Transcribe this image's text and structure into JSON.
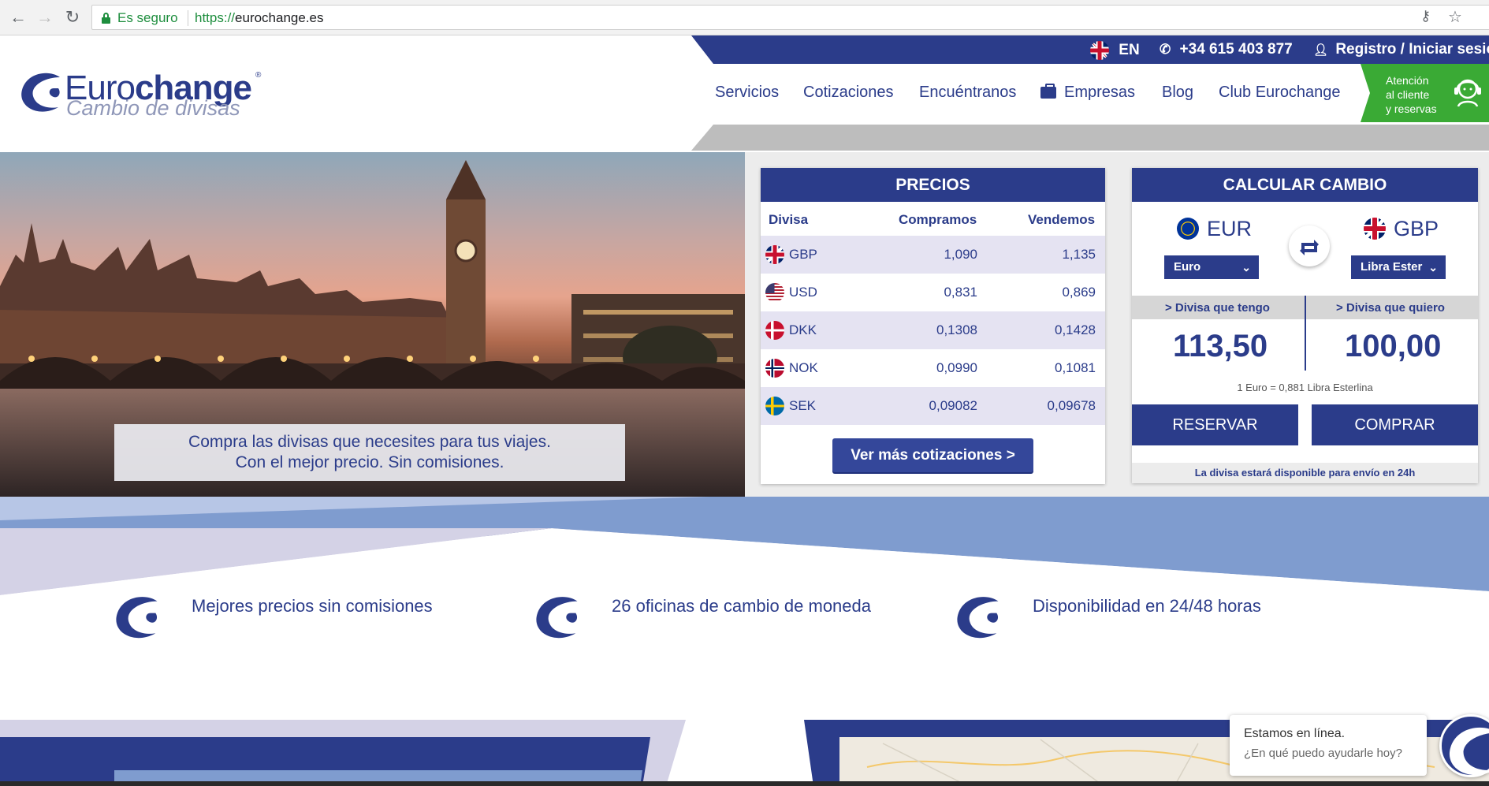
{
  "browser": {
    "secure_label": "Es seguro",
    "url_scheme": "https://",
    "url_host": "eurochange.es"
  },
  "topbar": {
    "language": "EN",
    "phone": "+34 615 403 877",
    "login": "Registro / Iniciar sesión"
  },
  "brand": {
    "name_light": "Euro",
    "name_bold": "change",
    "tagline": "Cambio de divisas"
  },
  "nav": {
    "items": [
      "Servicios",
      "Cotizaciones",
      "Encuéntranos",
      "Empresas",
      "Blog",
      "Club Eurochange"
    ]
  },
  "assist": {
    "line1": "Atención",
    "line2": "al cliente",
    "line3": "y reservas"
  },
  "hero": {
    "line1": "Compra las divisas que necesites para tus viajes.",
    "line2": "Con el mejor precio. Sin comisiones."
  },
  "prices": {
    "title": "PRECIOS",
    "columns": [
      "Divisa",
      "Compramos",
      "Vendemos"
    ],
    "rows": [
      {
        "code": "GBP",
        "buy": "1,090",
        "sell": "1,135"
      },
      {
        "code": "USD",
        "buy": "0,831",
        "sell": "0,869"
      },
      {
        "code": "DKK",
        "buy": "0,1308",
        "sell": "0,1428"
      },
      {
        "code": "NOK",
        "buy": "0,0990",
        "sell": "0,1081"
      },
      {
        "code": "SEK",
        "buy": "0,09082",
        "sell": "0,09678"
      }
    ],
    "more_button": "Ver más cotizaciones >"
  },
  "calc": {
    "title": "CALCULAR CAMBIO",
    "from_code": "EUR",
    "to_code": "GBP",
    "from_select": "Euro",
    "to_select": "Libra Ester",
    "have_label": "> Divisa que tengo",
    "want_label": "> Divisa que quiero",
    "have_amount": "113,50",
    "want_amount": "100,00",
    "rate_text": "1 Euro = 0,881 Libra Esterlina",
    "reserve_button": "RESERVAR",
    "buy_button": "COMPRAR",
    "availability": "La divisa estará disponible para envío en 24h"
  },
  "features": [
    "Mejores precios sin comisiones",
    "26 oficinas de cambio de moneda",
    "Disponibilidad en 24/48 horas"
  ],
  "chat": {
    "title": "Estamos en línea.",
    "subtitle": "¿En qué puedo ayudarle hoy?"
  },
  "colors": {
    "brand_blue": "#2b3c8a",
    "assist_green": "#3aaa35",
    "row_alt": "#e5e3f2"
  }
}
